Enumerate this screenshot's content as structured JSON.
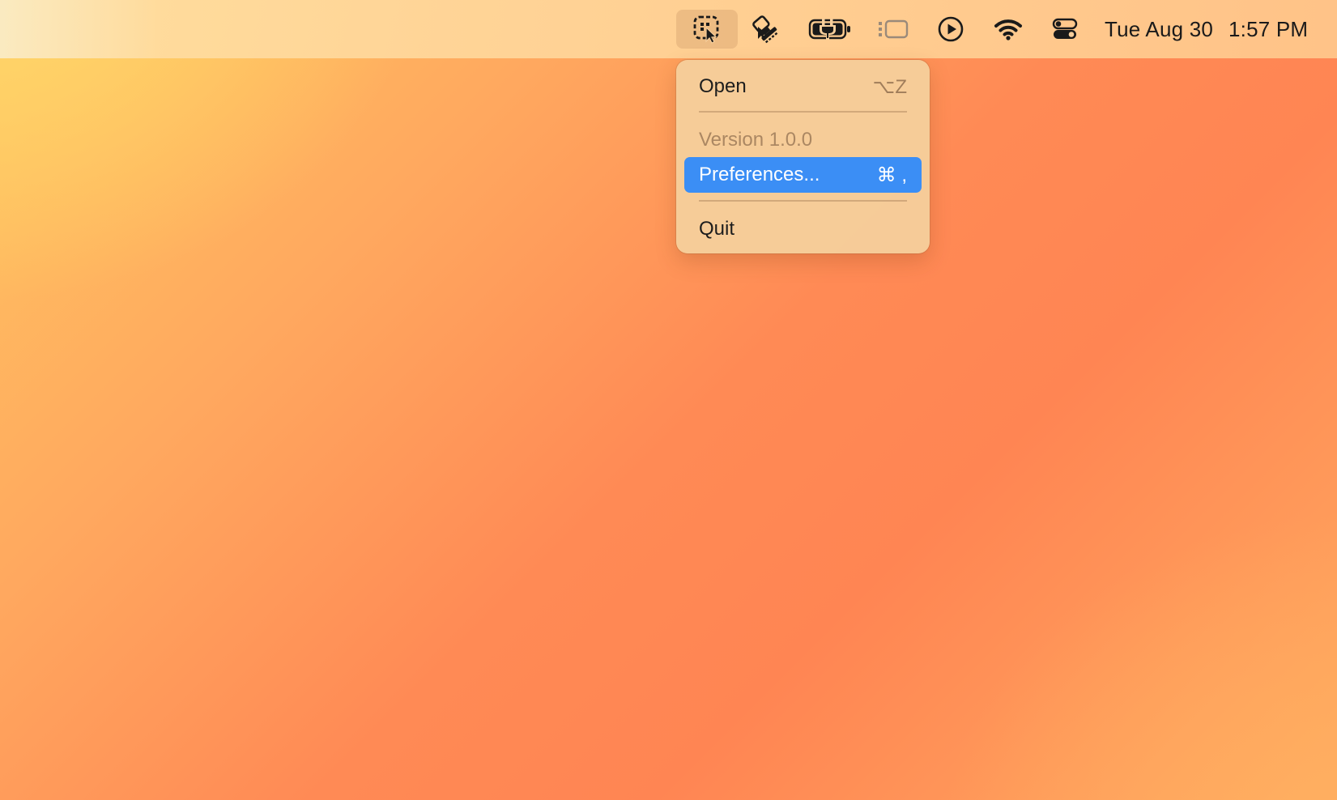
{
  "menubar": {
    "items": [
      {
        "name": "select-pointer-app-icon",
        "active": true
      },
      {
        "name": "stamp-cursor-icon",
        "active": false
      },
      {
        "name": "battery-charging-icon",
        "active": false
      },
      {
        "name": "sidebar-window-icon",
        "active": false
      },
      {
        "name": "play-circle-icon",
        "active": false
      },
      {
        "name": "wifi-icon",
        "active": false
      },
      {
        "name": "control-center-icon",
        "active": false
      }
    ],
    "clock": {
      "date": "Tue Aug 30",
      "time": "1:57 PM"
    }
  },
  "menu": {
    "open": {
      "label": "Open",
      "shortcut": "⌥Z"
    },
    "version": {
      "label": "Version 1.0.0"
    },
    "preferences": {
      "label": "Preferences...",
      "shortcut": "⌘ ,"
    },
    "quit": {
      "label": "Quit"
    }
  },
  "colors": {
    "highlight": "#3b8ef5",
    "menu_background": "#f6ce9b"
  }
}
